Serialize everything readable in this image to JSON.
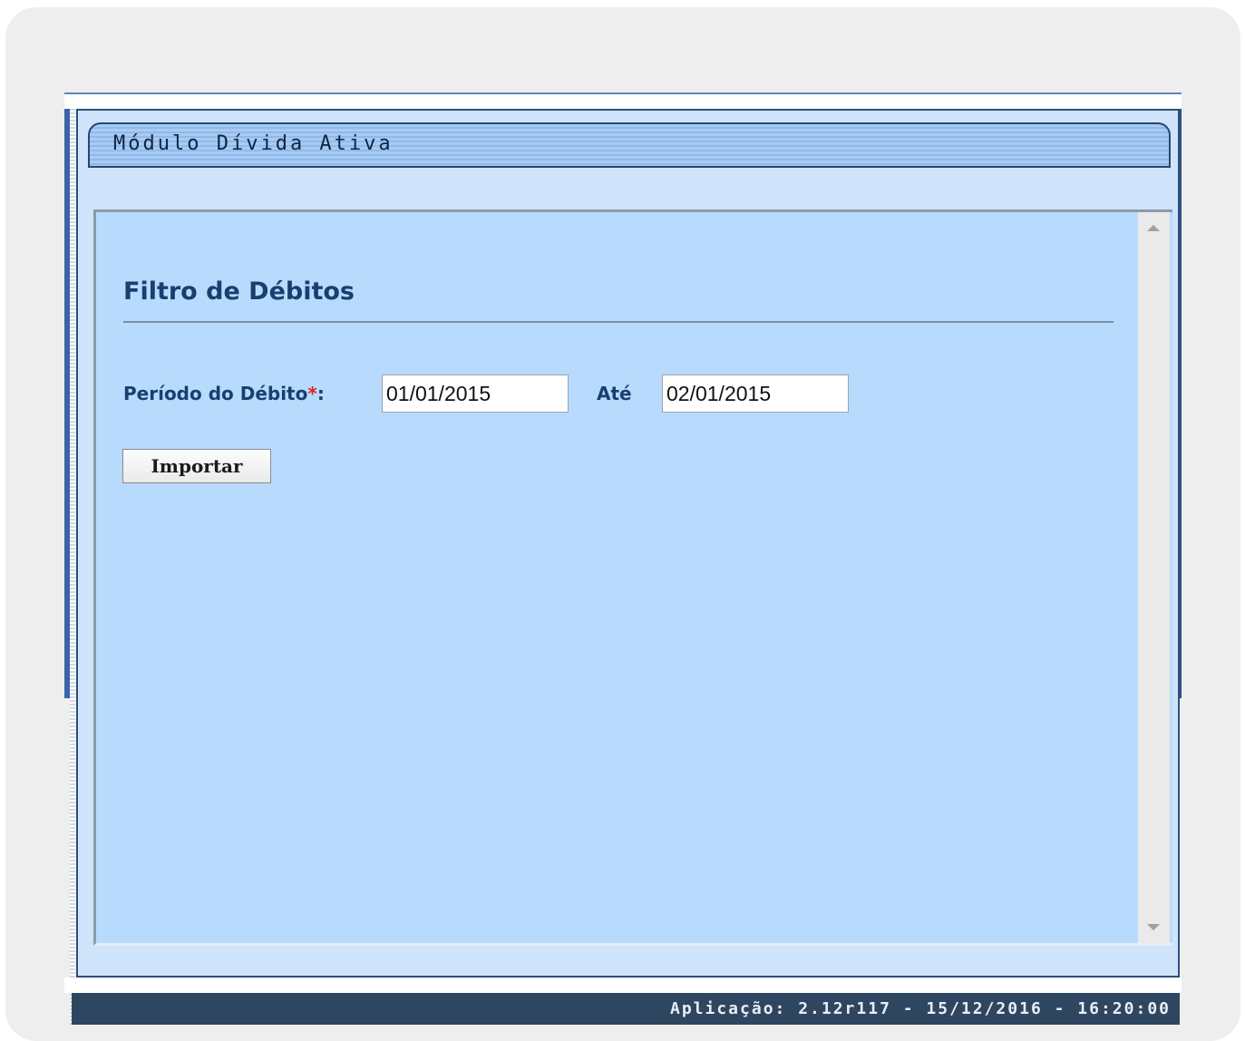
{
  "module": {
    "title": "Módulo Dívida Ativa"
  },
  "form": {
    "heading": "Filtro de Débitos",
    "period_label": "Período do Débito",
    "required_mark": "*",
    "label_suffix": ":",
    "start_date": "01/01/2015",
    "until_label": "Até",
    "end_date": "02/01/2015",
    "import_button": "Importar"
  },
  "footer": {
    "app_info": "Aplicação: 2.12r117 - 15/12/2016 - 16:20:00"
  },
  "icons": {
    "scroll_up": "triangle-up-icon",
    "scroll_down": "triangle-down-icon"
  },
  "colors": {
    "accent_text": "#17406f",
    "content_background": "#b8dbfd",
    "footer_background": "#2f4660",
    "required": "#e02020"
  }
}
